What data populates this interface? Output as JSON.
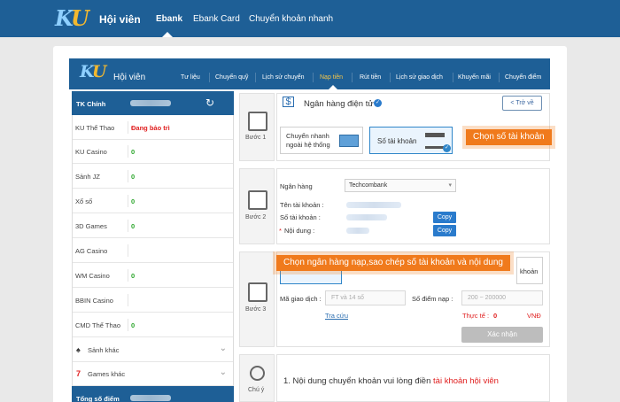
{
  "topbar": {
    "logo_k": "K",
    "logo_u": "U",
    "title": "Hội viên",
    "nav": [
      "Ebank",
      "Ebank Card",
      "Chuyển khoản nhanh"
    ]
  },
  "inner_header": {
    "logo_k": "K",
    "logo_u": "U",
    "title": "Hội viên",
    "nav": [
      "Tư liệu",
      "Chuyển quỹ",
      "Lịch sử chuyển",
      "Nạp tiền",
      "Rút tiền",
      "Lịch sử giao dịch",
      "Khuyến mãi",
      "Chuyển điểm"
    ]
  },
  "sidebar": {
    "main_label": "TK Chính",
    "rows": [
      {
        "name": "KU Thể Thao",
        "value": "Đang bảo trì"
      },
      {
        "name": "KU Casino",
        "value": "0"
      },
      {
        "name": "Sảnh JZ",
        "value": "0"
      },
      {
        "name": "Xổ số",
        "value": "0"
      },
      {
        "name": "3D Games",
        "value": "0"
      },
      {
        "name": "AG Casino",
        "value": ""
      },
      {
        "name": "WM Casino",
        "value": "0"
      },
      {
        "name": "BBIN Casino",
        "value": ""
      },
      {
        "name": "CMD Thể Thao",
        "value": "0"
      }
    ],
    "more": [
      "Sảnh khác",
      "Games khác"
    ],
    "total_label": "Tổng số điểm"
  },
  "steps": [
    "Bước 1",
    "Bước 2",
    "Bước 3",
    "Chú ý"
  ],
  "step1": {
    "title": "Ngân hàng điện tử",
    "back": "Trở về",
    "option_fast": "Chuyển nhanh ngoài hệ thống",
    "option_account": "Số tài khoản",
    "callout": "Chọn số tài khoản"
  },
  "step2": {
    "bank_label": "Ngân hàng",
    "bank_value": "Techcombank",
    "account_name_label": "Tên tài khoản :",
    "account_no_label": "Số tài khoản :",
    "content_label": "Nội dung :",
    "required_mark": "*",
    "copy": "Copy",
    "callout": "Chọn ngân hàng nạp,sao chép số tài khoản và nội dung"
  },
  "step3": {
    "partial_option": "khoản",
    "txn_label": "Mã giao dịch :",
    "txn_placeholder": "FT và 14 số",
    "points_label": "Số điểm nạp :",
    "points_placeholder": "200 ~ 200000",
    "lookup": "Tra cứu",
    "actual_label": "Thực tế :",
    "actual_value": "0",
    "currency": "VNĐ",
    "submit": "Xác nhận"
  },
  "note": {
    "prefix": "1.  Nội dung chuyển khoản vui lòng điền",
    "highlight": "tài khoản hội viên"
  }
}
